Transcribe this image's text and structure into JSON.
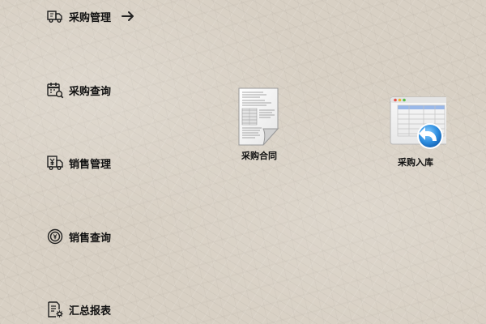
{
  "sidebar": {
    "items": [
      {
        "label": "采购管理",
        "icon": "delivery-truck-icon"
      },
      {
        "label": "采购查询",
        "icon": "calendar-search-icon"
      },
      {
        "label": "销售管理",
        "icon": "yen-box-truck-icon"
      },
      {
        "label": "销售查询",
        "icon": "coin-search-icon"
      },
      {
        "label": "汇总报表",
        "icon": "report-gear-icon"
      }
    ]
  },
  "desktop": {
    "icons": [
      {
        "label": "采购合同",
        "icon": "document-icon"
      },
      {
        "label": "采购入库",
        "icon": "spreadsheet-return-icon"
      }
    ]
  },
  "colors": {
    "accent_blue": "#2f8fe0",
    "background": "#d8d0c4"
  }
}
